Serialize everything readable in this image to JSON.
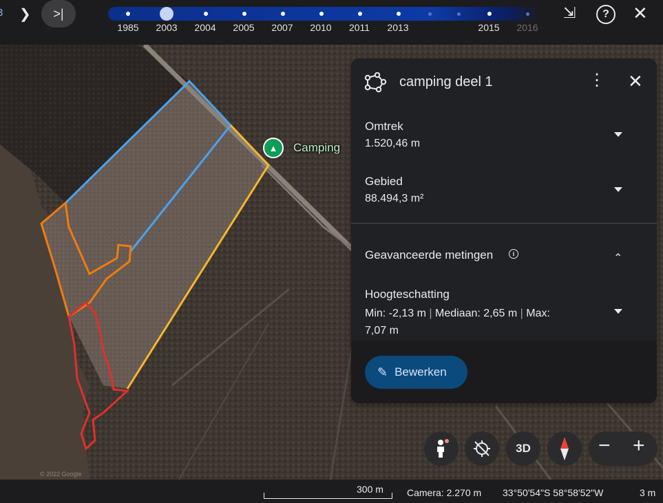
{
  "timeline": {
    "years": [
      "1985",
      "2003",
      "2004",
      "2005",
      "2007",
      "2010",
      "2011",
      "2013",
      "2015",
      "2016"
    ],
    "selected": "2003"
  },
  "map": {
    "poi_label": "Camping",
    "credit": "© 2022 Google",
    "poi_color": "#0f9d58"
  },
  "panel": {
    "title": "camping deel 1",
    "perimeter_label": "Omtrek",
    "perimeter_value": "1.520,46 m",
    "area_label": "Gebied",
    "area_value": "88.494,3 m²",
    "advanced_label": "Geavanceerde metingen",
    "height_label": "Hoogteschatting",
    "height_min": "Min: -2,13 m",
    "height_median": "Mediaan: 2,65 m",
    "height_max": "Max: 7,07 m",
    "edit_label": "Bewerken"
  },
  "controls": {
    "three_d_label": "3D",
    "zoom_out_label": "−",
    "zoom_in_label": "+"
  },
  "status": {
    "scale": "300 m",
    "camera": "Camera: 2.270 m",
    "coordinates": "33°50'54\"S 58°58'52\"W",
    "elevation": "3 m"
  },
  "colors": {
    "outline_blue": "#4aa3f0",
    "outline_orange": "#f07c0e",
    "outline_yellow": "#f5b62b",
    "outline_red": "#e0302d",
    "accent_button": "#0b4a7d",
    "timeline": "#0e3aa6"
  }
}
